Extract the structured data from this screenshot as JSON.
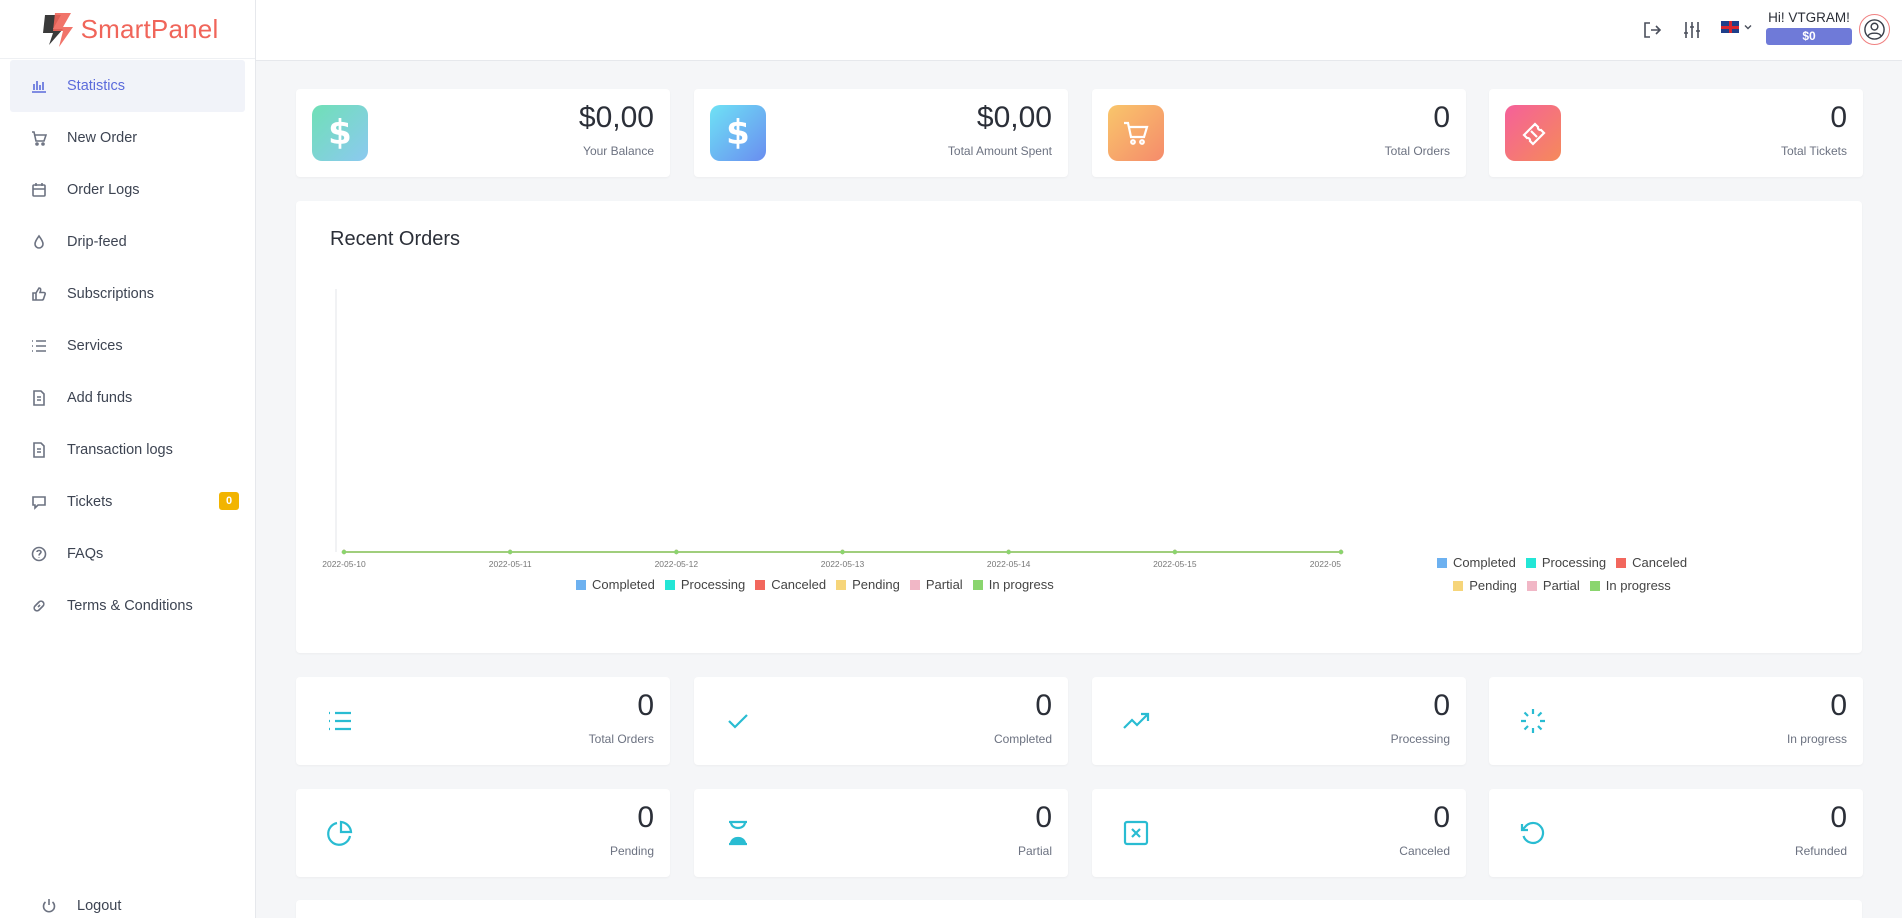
{
  "app": {
    "name": "SmartPanel"
  },
  "sidebar": {
    "items": [
      {
        "label": "Statistics",
        "icon": "bar-chart-icon",
        "active": true
      },
      {
        "label": "New Order",
        "icon": "cart-icon"
      },
      {
        "label": "Order Logs",
        "icon": "calendar-icon"
      },
      {
        "label": "Drip-feed",
        "icon": "droplet-icon"
      },
      {
        "label": "Subscriptions",
        "icon": "thumbs-up-icon"
      },
      {
        "label": "Services",
        "icon": "list-icon"
      },
      {
        "label": "Add funds",
        "icon": "file-icon"
      },
      {
        "label": "Transaction logs",
        "icon": "file-icon"
      },
      {
        "label": "Tickets",
        "icon": "chat-icon",
        "badge": "0"
      },
      {
        "label": "FAQs",
        "icon": "help-circle-icon"
      },
      {
        "label": "Terms & Conditions",
        "icon": "link-icon"
      }
    ],
    "logout": "Logout"
  },
  "header": {
    "greeting": "Hi! VTGRAM!",
    "balance": "$0"
  },
  "top_stats": [
    {
      "value": "$0,00",
      "label": "Your Balance"
    },
    {
      "value": "$0,00",
      "label": "Total Amount Spent"
    },
    {
      "value": "0",
      "label": "Total Orders"
    },
    {
      "value": "0",
      "label": "Total Tickets"
    }
  ],
  "recent_orders": {
    "title": "Recent Orders"
  },
  "chart_data": [
    {
      "type": "line",
      "x": [
        "2022-05-10",
        "2022-05-11",
        "2022-05-12",
        "2022-05-13",
        "2022-05-14",
        "2022-05-15",
        "2022-05"
      ],
      "series": [
        {
          "name": "Completed",
          "values": [
            0,
            0,
            0,
            0,
            0,
            0,
            0
          ]
        },
        {
          "name": "Processing",
          "values": [
            0,
            0,
            0,
            0,
            0,
            0,
            0
          ]
        },
        {
          "name": "Canceled",
          "values": [
            0,
            0,
            0,
            0,
            0,
            0,
            0
          ]
        },
        {
          "name": "Pending",
          "values": [
            0,
            0,
            0,
            0,
            0,
            0,
            0
          ]
        },
        {
          "name": "Partial",
          "values": [
            0,
            0,
            0,
            0,
            0,
            0,
            0
          ]
        },
        {
          "name": "In progress",
          "values": [
            0,
            0,
            0,
            0,
            0,
            0,
            0
          ]
        }
      ],
      "colors": [
        "#6db1f0",
        "#23e6d6",
        "#f2675d",
        "#f6d57a",
        "#f1b7c6",
        "#8ad56e"
      ],
      "legend": "bottom",
      "grid": false
    },
    {
      "type": "pie",
      "labels": [
        "Completed",
        "Processing",
        "Canceled",
        "Pending",
        "Partial",
        "In progress"
      ],
      "values": [
        0,
        0,
        0,
        0,
        0,
        0
      ],
      "colors": [
        "#6db1f0",
        "#23e6d6",
        "#f2675d",
        "#f6d57a",
        "#f1b7c6",
        "#8ad56e"
      ],
      "legend": "bottom"
    }
  ],
  "status_stats": [
    {
      "value": "0",
      "label": "Total Orders",
      "icon": "list-icon"
    },
    {
      "value": "0",
      "label": "Completed",
      "icon": "check-icon"
    },
    {
      "value": "0",
      "label": "Processing",
      "icon": "trending-up-icon"
    },
    {
      "value": "0",
      "label": "In progress",
      "icon": "loader-icon"
    },
    {
      "value": "0",
      "label": "Pending",
      "icon": "pie-chart-icon"
    },
    {
      "value": "0",
      "label": "Partial",
      "icon": "hourglass-icon"
    },
    {
      "value": "0",
      "label": "Canceled",
      "icon": "x-square-icon"
    },
    {
      "value": "0",
      "label": "Refunded",
      "icon": "rotate-ccw-icon"
    }
  ]
}
